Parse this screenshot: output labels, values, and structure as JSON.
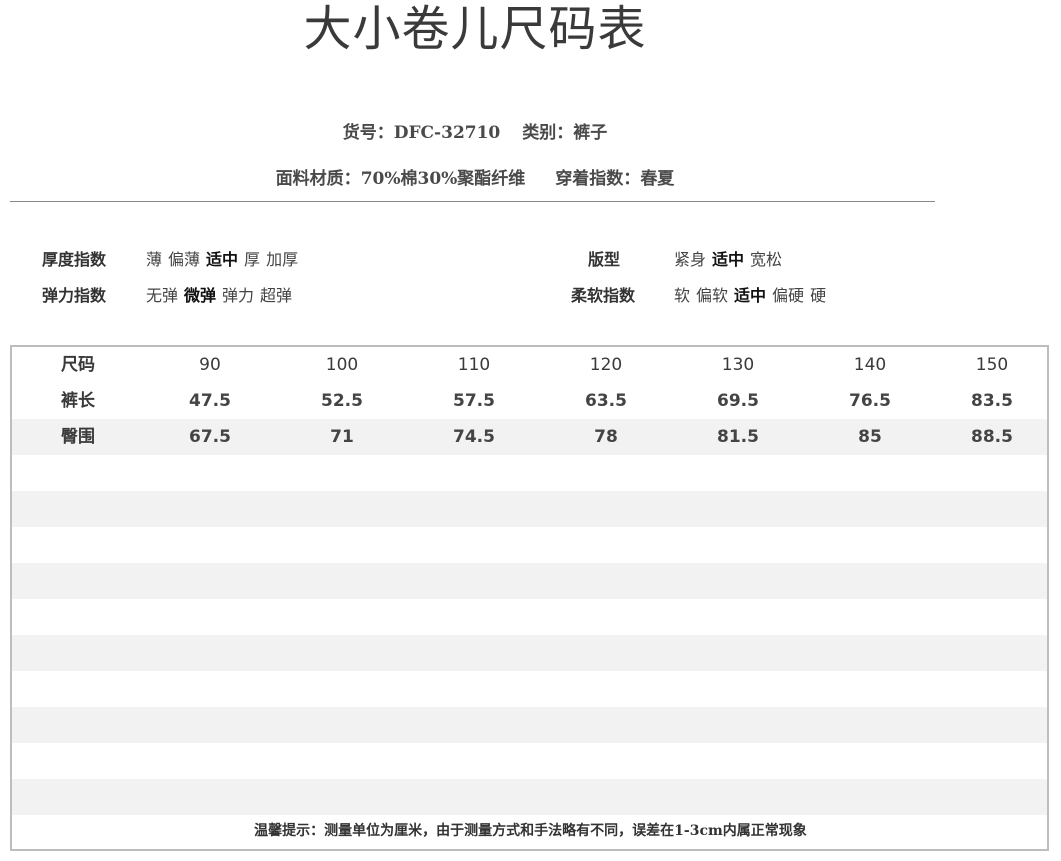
{
  "title": "大小卷儿尺码表",
  "info": {
    "item_no_label": "货号：",
    "item_no": "DFC-32710",
    "category_label": "类别：",
    "category": "裤子",
    "fabric_label": "面料材质：",
    "fabric": "70%棉30%聚酯纤维",
    "season_label": "穿着指数：",
    "season": "春夏"
  },
  "attributes": {
    "thickness": {
      "label": "厚度指数",
      "options": [
        "薄",
        "偏薄",
        "适中",
        "厚",
        "加厚"
      ],
      "selected": "适中"
    },
    "elasticity": {
      "label": "弹力指数",
      "options": [
        "无弹",
        "微弹",
        "弹力",
        "超弹"
      ],
      "selected": "微弹"
    },
    "fit": {
      "label": "版型",
      "options": [
        "紧身",
        "适中",
        "宽松"
      ],
      "selected": "适中"
    },
    "softness": {
      "label": "柔软指数",
      "options": [
        "软",
        "偏软",
        "适中",
        "偏硬",
        "硬"
      ],
      "selected": "适中"
    }
  },
  "size_table": {
    "header": [
      "尺码",
      "90",
      "100",
      "110",
      "120",
      "130",
      "140",
      "150"
    ],
    "rows": [
      [
        "裤长",
        "47.5",
        "52.5",
        "57.5",
        "63.5",
        "69.5",
        "76.5",
        "83.5"
      ],
      [
        "臀围",
        "67.5",
        "71",
        "74.5",
        "78",
        "81.5",
        "85",
        "88.5"
      ]
    ]
  },
  "tip": "温馨提示：测量单位为厘米，由于测量方式和手法略有不同，误差在1-3cm内属正常现象",
  "colors": {
    "row_shade": "#f2f2f2",
    "border": "#bdbdbd",
    "text": "#333333"
  }
}
